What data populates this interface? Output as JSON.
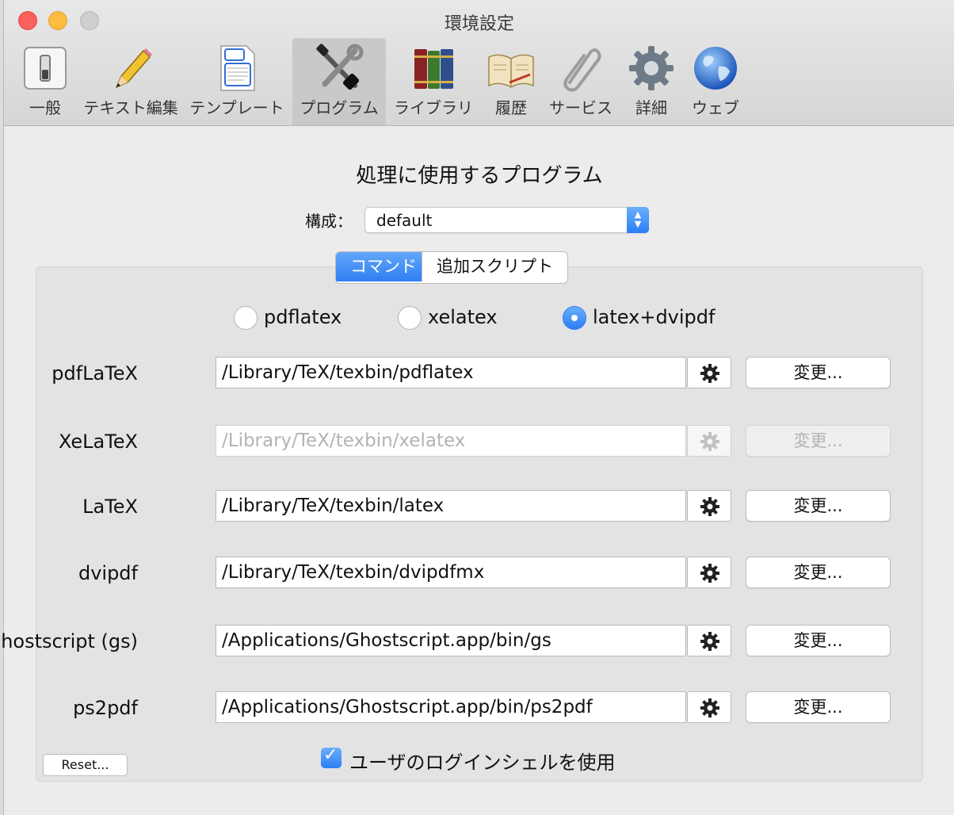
{
  "window": {
    "title": "環境設定"
  },
  "toolbar": {
    "items": [
      {
        "label": "一般",
        "icon": "switch-icon"
      },
      {
        "label": "テキスト編集",
        "icon": "pencil-icon"
      },
      {
        "label": "テンプレート",
        "icon": "template-document-icon"
      },
      {
        "label": "プログラム",
        "icon": "tools-icon",
        "selected": true
      },
      {
        "label": "ライブラリ",
        "icon": "books-icon"
      },
      {
        "label": "履歴",
        "icon": "open-book-icon"
      },
      {
        "label": "サービス",
        "icon": "paperclip-icon"
      },
      {
        "label": "詳細",
        "icon": "gear-icon"
      },
      {
        "label": "ウェブ",
        "icon": "globe-icon"
      }
    ]
  },
  "main": {
    "heading": "処理に使用するプログラム",
    "config_label": "構成：",
    "config_value": "default",
    "tabs": [
      {
        "label": "コマンド",
        "active": true
      },
      {
        "label": "追加スクリプト",
        "active": false
      }
    ],
    "radios": [
      {
        "label": "pdflatex",
        "selected": false
      },
      {
        "label": "xelatex",
        "selected": false
      },
      {
        "label": "latex+dvipdf",
        "selected": true
      }
    ],
    "programs": [
      {
        "label": "pdfLaTeX",
        "path": "/Library/TeX/texbin/pdflatex",
        "button": "変更...",
        "enabled": true
      },
      {
        "label": "XeLaTeX",
        "path": "/Library/TeX/texbin/xelatex",
        "button": "変更...",
        "enabled": false
      },
      {
        "label": "LaTeX",
        "path": "/Library/TeX/texbin/latex",
        "button": "変更...",
        "enabled": true
      },
      {
        "label": "dvipdf",
        "path": "/Library/TeX/texbin/dvipdfmx",
        "button": "変更...",
        "enabled": true
      },
      {
        "label": "Ghostscript (gs)",
        "path": "/Applications/Ghostscript.app/bin/gs",
        "button": "変更...",
        "enabled": true
      },
      {
        "label": "ps2pdf",
        "path": "/Applications/Ghostscript.app/bin/ps2pdf",
        "button": "変更...",
        "enabled": true
      }
    ],
    "reset_label": "Reset...",
    "login_shell_label": "ユーザのログインシェルを使用",
    "login_shell_checked": true
  },
  "colors": {
    "accent": "#2f7ef3",
    "close": "#fc605c",
    "minimize": "#fdbc40"
  }
}
